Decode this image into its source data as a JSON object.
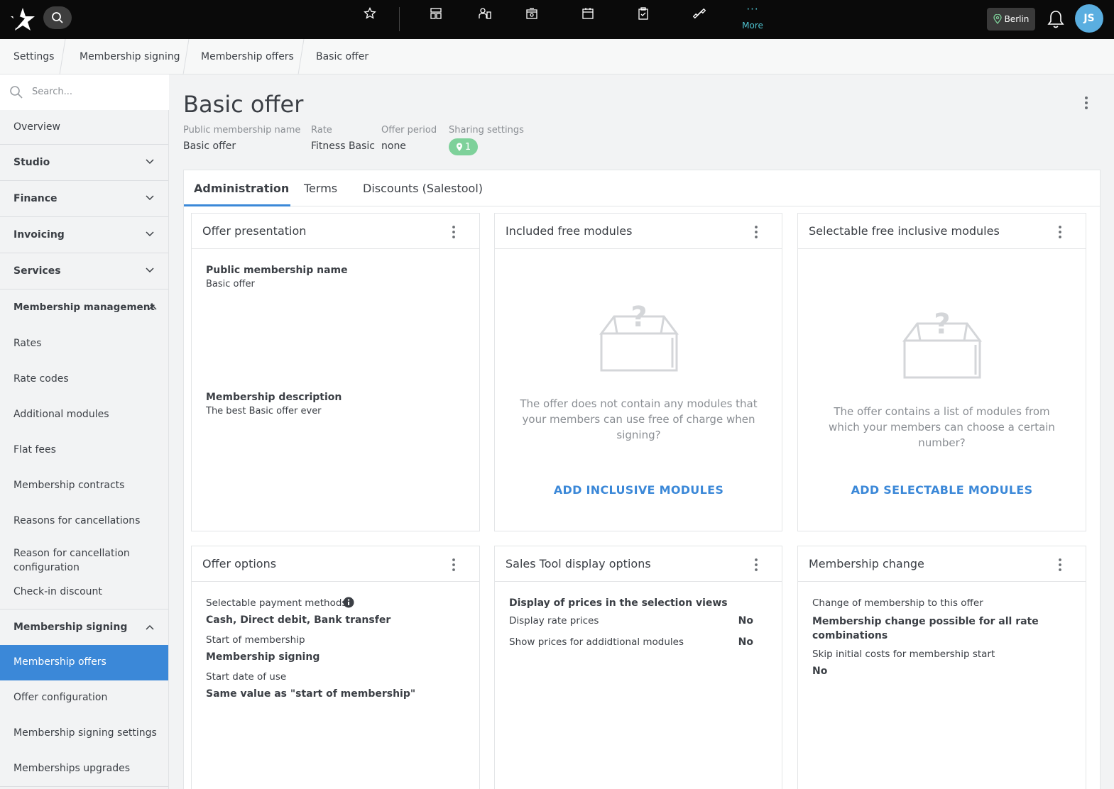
{
  "topbar": {
    "more_label": "More",
    "location": "Berlin",
    "avatar_initials": "JS",
    "nav_icons": [
      "star-icon",
      "dashboard-icon",
      "members-icon",
      "checkin-icon",
      "calendar-icon",
      "clipboard-icon",
      "fitness-icon"
    ]
  },
  "breadcrumb": [
    "Settings",
    "Membership signing",
    "Membership offers",
    "Basic offer"
  ],
  "sidebar": {
    "search_placeholder": "Search...",
    "items": [
      {
        "label": "Overview"
      },
      {
        "label": "Studio"
      },
      {
        "label": "Finance"
      },
      {
        "label": "Invoicing"
      },
      {
        "label": "Services"
      },
      {
        "label": "Membership management"
      },
      {
        "label": "Rates"
      },
      {
        "label": "Rate codes"
      },
      {
        "label": "Additional modules"
      },
      {
        "label": "Flat fees"
      },
      {
        "label": "Membership contracts"
      },
      {
        "label": "Reasons for cancellations"
      },
      {
        "label": "Reason for cancellation configuration"
      },
      {
        "label": "Check-in discount"
      },
      {
        "label": "Membership signing"
      },
      {
        "label": "Membership offers"
      },
      {
        "label": "Offer configuration"
      },
      {
        "label": "Membership signing settings"
      },
      {
        "label": "Memberships upgrades"
      }
    ]
  },
  "page": {
    "title": "Basic offer",
    "meta": {
      "public_name_label": "Public membership name",
      "public_name_value": "Basic offer",
      "rate_label": "Rate",
      "rate_value": "Fitness Basic",
      "period_label": "Offer period",
      "period_value": "none",
      "sharing_label": "Sharing settings",
      "sharing_count": "1"
    }
  },
  "tabs": [
    "Administration",
    "Terms",
    "Discounts (Salestool)"
  ],
  "cards": {
    "offer_presentation": {
      "title": "Offer presentation",
      "name_label": "Public membership name",
      "name_value": "Basic offer",
      "desc_label": "Membership description",
      "desc_value": "The best Basic offer ever"
    },
    "included_modules": {
      "title": "Included free modules",
      "empty_text": "The offer does not contain any modules that your members can use free of charge when signing?",
      "action": "ADD INCLUSIVE MODULES"
    },
    "selectable_modules": {
      "title": "Selectable free inclusive modules",
      "empty_text": "The offer contains a list of modules from which your members can choose a certain number?",
      "action": "ADD SELECTABLE MODULES"
    },
    "offer_options": {
      "title": "Offer options",
      "payment_label": "Selectable payment methods",
      "payment_value": "Cash, Direct debit, Bank transfer",
      "start_label": "Start of membership",
      "start_value": "Membership signing",
      "use_label": "Start date of use",
      "use_value": "Same value as \"start of membership\""
    },
    "sales_tool": {
      "title": "Sales Tool display options",
      "section_label": "Display of prices in the selection views",
      "rate_prices_label": "Display rate prices",
      "rate_prices_value": "No",
      "module_prices_label": "Show prices for addidtional modules",
      "module_prices_value": "No"
    },
    "membership_change": {
      "title": "Membership change",
      "change_label": "Change of membership to this offer",
      "change_value": "Membership change possible for all rate combinations",
      "skip_label": "Skip initial costs for membership start",
      "skip_value": "No"
    }
  },
  "colors": {
    "accent": "#3b88d8",
    "badge": "#7ed19a",
    "more": "#4fc3d0",
    "avatar": "#5aaee0"
  }
}
